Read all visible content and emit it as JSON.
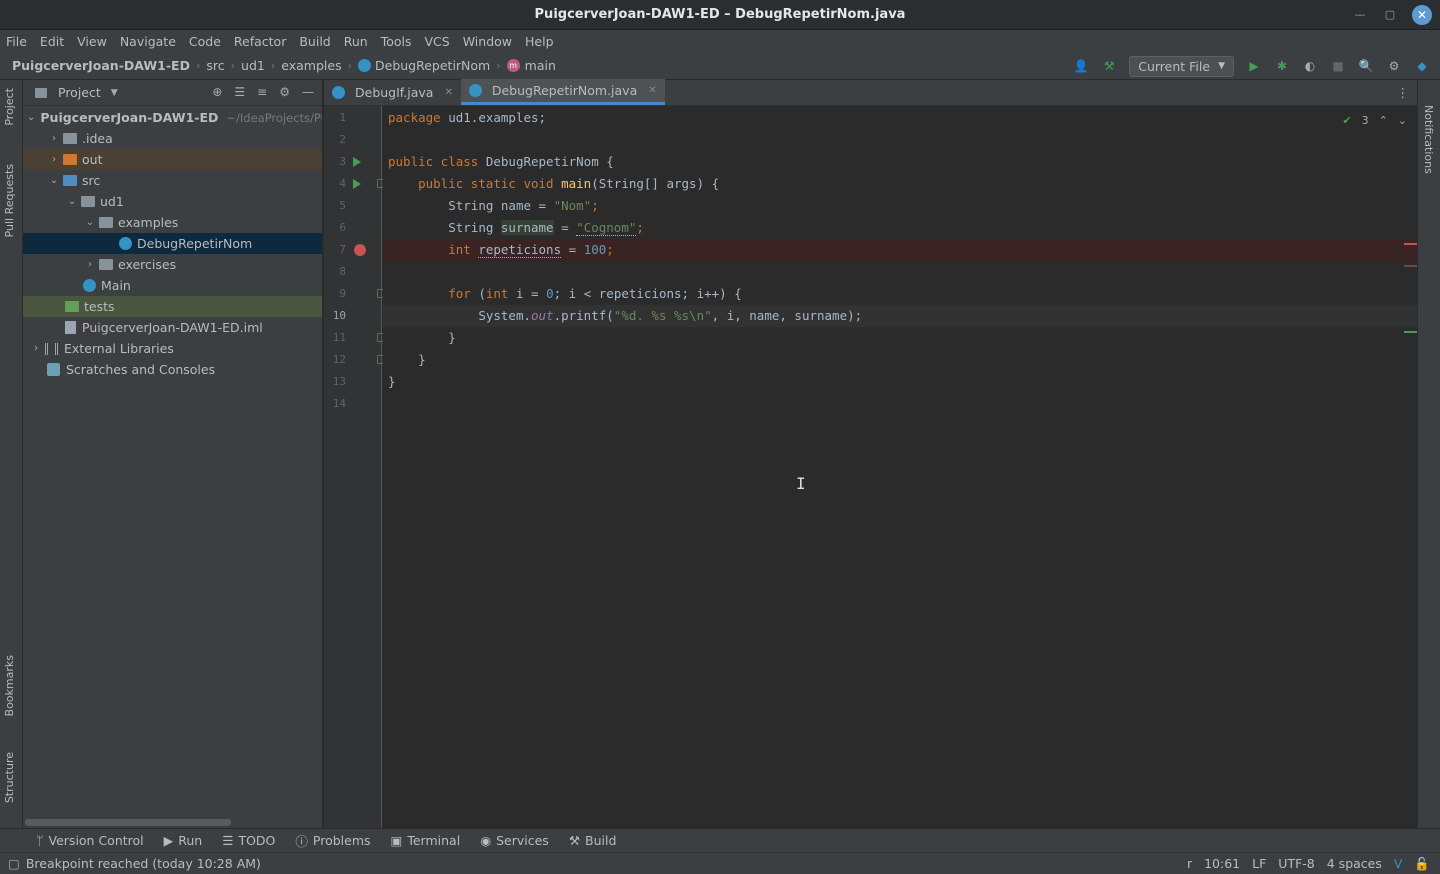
{
  "window": {
    "title": "PuigcerverJoan-DAW1-ED – DebugRepetirNom.java"
  },
  "menu": [
    "File",
    "Edit",
    "View",
    "Navigate",
    "Code",
    "Refactor",
    "Build",
    "Run",
    "Tools",
    "VCS",
    "Window",
    "Help"
  ],
  "breadcrumb": {
    "project": "PuigcerverJoan-DAW1-ED",
    "p1": "src",
    "p2": "ud1",
    "p3": "examples",
    "cls": "DebugRepetirNom",
    "method": "main"
  },
  "run_config": "Current File",
  "project_panel": {
    "label": "Project",
    "root": "PuigcerverJoan-DAW1-ED",
    "root_path": "~/IdeaProjects/Pui",
    "items": {
      "idea": ".idea",
      "out": "out",
      "src": "src",
      "ud1": "ud1",
      "examples": "examples",
      "debug": "DebugRepetirNom",
      "exercises": "exercises",
      "main": "Main",
      "tests": "tests",
      "iml": "PuigcerverJoan-DAW1-ED.iml",
      "ext": "External Libraries",
      "scratch": "Scratches and Consoles"
    }
  },
  "tabs": [
    {
      "label": "DebugIf.java"
    },
    {
      "label": "DebugRepetirNom.java"
    }
  ],
  "editor": {
    "line_numbers": [
      "1",
      "2",
      "3",
      "4",
      "5",
      "6",
      "7",
      "8",
      "9",
      "10",
      "11",
      "12",
      "13",
      "14"
    ],
    "inspection_count": "3",
    "code": {
      "l1_kw": "package",
      "l1_rest": " ud1.examples;",
      "l3_kw1": "public class",
      "l3_name": " DebugRepetirNom",
      "l3_rest": " {",
      "l4_kw": "public static void",
      "l4_fn": "main",
      "l4_rest": "(String[] args) {",
      "l5_type": "String",
      "l5_var": " name = ",
      "l5_str": "\"Nom\"",
      "l5_end": ";",
      "l6_type": "String",
      "l6_var": "surname",
      "l6_eq": " = ",
      "l6_str": "\"Cognom\"",
      "l6_end": ";",
      "l7_kw": "int",
      "l7_var": "repeticions",
      "l7_eq": " = ",
      "l7_num": "100",
      "l7_end": ";",
      "l9_kw": "for",
      "l9_a": " (",
      "l9_int": "int",
      "l9_b": " i = ",
      "l9_zero": "0",
      "l9_c": "; i < repeticions; i++) {",
      "l10_a": "System.",
      "l10_out": "out",
      "l10_b": ".printf(",
      "l10_str": "\"%d. %s %s\\n\"",
      "l10_c": ", i, name, surname);",
      "l11": "}",
      "l12": "}",
      "l13": "}"
    }
  },
  "side_tabs": {
    "project": "Project",
    "pull": "Pull Requests",
    "bookmarks": "Bookmarks",
    "structure": "Structure",
    "notifications": "Notifications"
  },
  "bottom_tools": [
    "Version Control",
    "Run",
    "TODO",
    "Problems",
    "Terminal",
    "Services",
    "Build"
  ],
  "status": {
    "message": "Breakpoint reached (today 10:28 AM)",
    "r": "r",
    "pos": "10:61",
    "eol": "LF",
    "enc": "UTF-8",
    "indent": "4 spaces"
  }
}
